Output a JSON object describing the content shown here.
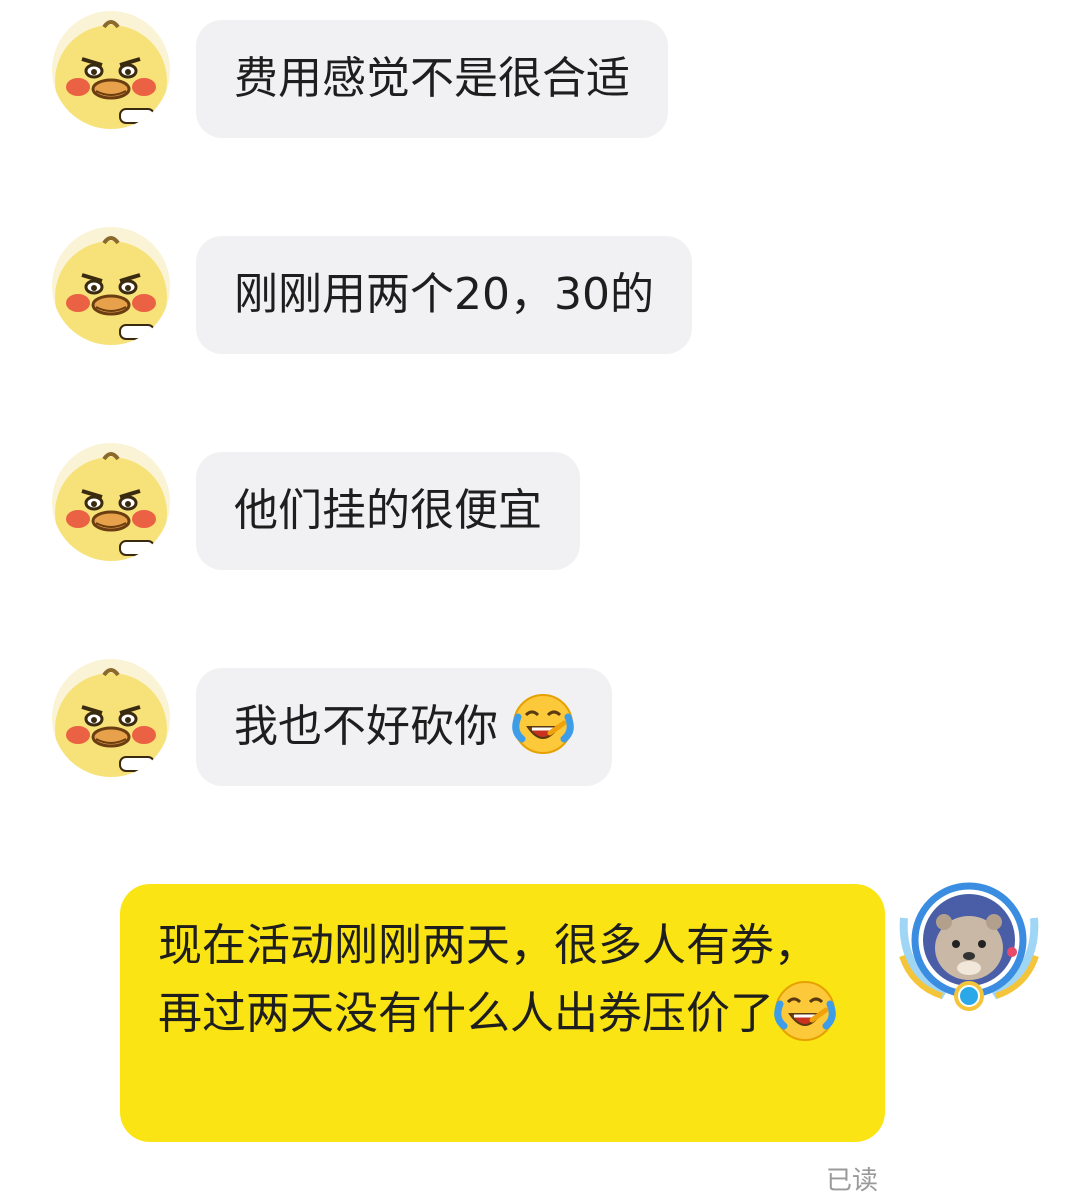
{
  "messages_incoming": [
    {
      "text": "费用感觉不是很合适"
    },
    {
      "text": "刚刚用两个20，30的"
    },
    {
      "text": "他们挂的很便宜"
    },
    {
      "text": "我也不好砍你",
      "emoji": "crying-laughing-emoji"
    }
  ],
  "message_outgoing": {
    "text": "现在活动刚刚两天，很多人有券，再过两天没有什么人出券压价了",
    "emoji": "crying-laughing-emoji"
  },
  "status": {
    "read_label": "已读"
  },
  "colors": {
    "incoming_bubble": "#f1f1f3",
    "outgoing_bubble": "#fbe414",
    "text": "#1e1e1e",
    "read": "#9a9a9a"
  }
}
